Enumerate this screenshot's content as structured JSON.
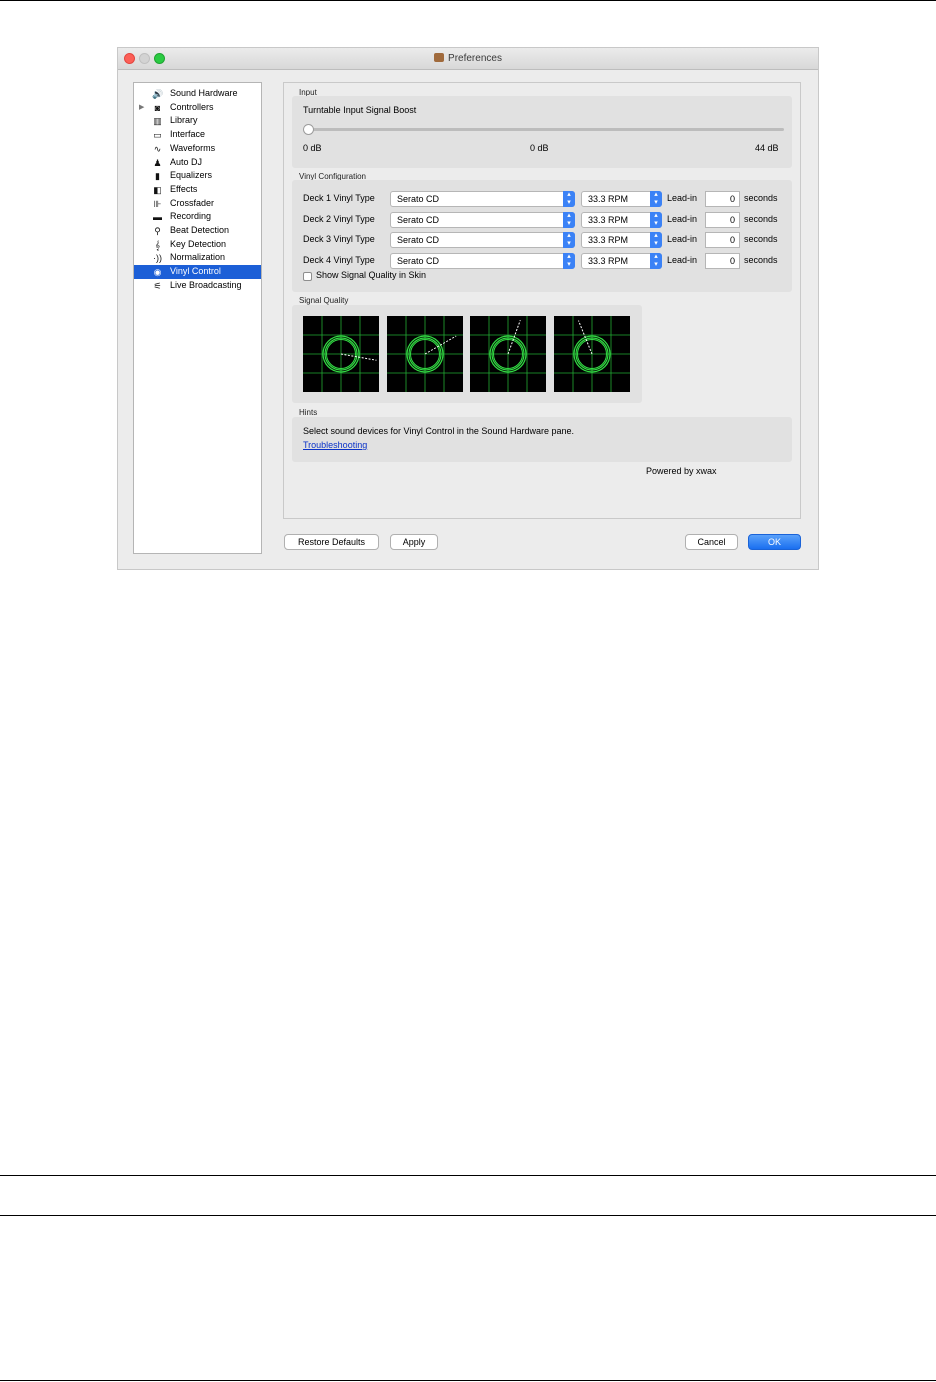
{
  "window": {
    "title": "Preferences"
  },
  "sidebar": {
    "items": [
      {
        "label": "Sound Hardware",
        "icon": "speaker-icon",
        "glyph": "🔊",
        "expandable": false,
        "selected": false
      },
      {
        "label": "Controllers",
        "icon": "controller-icon",
        "glyph": "◙",
        "expandable": true,
        "selected": false
      },
      {
        "label": "Library",
        "icon": "library-icon",
        "glyph": "▥",
        "expandable": false,
        "selected": false
      },
      {
        "label": "Interface",
        "icon": "monitor-icon",
        "glyph": "▭",
        "expandable": false,
        "selected": false
      },
      {
        "label": "Waveforms",
        "icon": "waveforms-icon",
        "glyph": "∿",
        "expandable": false,
        "selected": false
      },
      {
        "label": "Auto DJ",
        "icon": "robot-icon",
        "glyph": "♟",
        "expandable": false,
        "selected": false
      },
      {
        "label": "Equalizers",
        "icon": "equalizer-icon",
        "glyph": "▮",
        "expandable": false,
        "selected": false
      },
      {
        "label": "Effects",
        "icon": "effects-icon",
        "glyph": "◧",
        "expandable": false,
        "selected": false
      },
      {
        "label": "Crossfader",
        "icon": "crossfader-icon",
        "glyph": "⊪",
        "expandable": false,
        "selected": false
      },
      {
        "label": "Recording",
        "icon": "recording-icon",
        "glyph": "▬",
        "expandable": false,
        "selected": false
      },
      {
        "label": "Beat Detection",
        "icon": "metronome-icon",
        "glyph": "⚲",
        "expandable": false,
        "selected": false
      },
      {
        "label": "Key Detection",
        "icon": "clef-icon",
        "glyph": "𝄞",
        "expandable": false,
        "selected": false
      },
      {
        "label": "Normalization",
        "icon": "volume-waves-icon",
        "glyph": "·))",
        "expandable": false,
        "selected": false
      },
      {
        "label": "Vinyl Control",
        "icon": "vinyl-icon",
        "glyph": "◉",
        "expandable": false,
        "selected": true
      },
      {
        "label": "Live Broadcasting",
        "icon": "antenna-icon",
        "glyph": "⚟",
        "expandable": false,
        "selected": false
      }
    ]
  },
  "input": {
    "section_title": "Input",
    "boost_label": "Turntable Input Signal Boost",
    "min_label": "0 dB",
    "mid_label": "0 dB",
    "max_label": "44 dB",
    "value_db": 0
  },
  "vinyl_config": {
    "section_title": "Vinyl Configuration",
    "lead_in_label": "Lead-in",
    "seconds_label": "seconds",
    "decks": [
      {
        "label": "Deck 1 Vinyl Type",
        "type": "Serato CD",
        "speed": "33.3 RPM",
        "lead_in": "0"
      },
      {
        "label": "Deck 2 Vinyl Type",
        "type": "Serato CD",
        "speed": "33.3 RPM",
        "lead_in": "0"
      },
      {
        "label": "Deck 3 Vinyl Type",
        "type": "Serato CD",
        "speed": "33.3 RPM",
        "lead_in": "0"
      },
      {
        "label": "Deck 4 Vinyl Type",
        "type": "Serato CD",
        "speed": "33.3 RPM",
        "lead_in": "0"
      }
    ],
    "show_quality_label": "Show Signal Quality in Skin",
    "show_quality_checked": false
  },
  "signal_quality": {
    "section_title": "Signal Quality",
    "scopes": [
      {
        "name": "deck-1",
        "angle_deg": 10
      },
      {
        "name": "deck-2",
        "angle_deg": -30
      },
      {
        "name": "deck-3",
        "angle_deg": -70
      },
      {
        "name": "deck-4",
        "angle_deg": -112
      }
    ],
    "colors": {
      "grid": "#22aa33",
      "ring": "#33dd44",
      "needle": "#ffffff",
      "background": "#000000"
    }
  },
  "hints": {
    "section_title": "Hints",
    "text": "Select sound devices for Vinyl Control in the Sound Hardware pane.",
    "link": "Troubleshooting"
  },
  "powered_by": "Powered by xwax",
  "buttons": {
    "restore_defaults": "Restore Defaults",
    "apply": "Apply",
    "cancel": "Cancel",
    "ok": "OK"
  },
  "colors": {
    "accent": "#1c5fd7",
    "link": "#0a32c8"
  }
}
